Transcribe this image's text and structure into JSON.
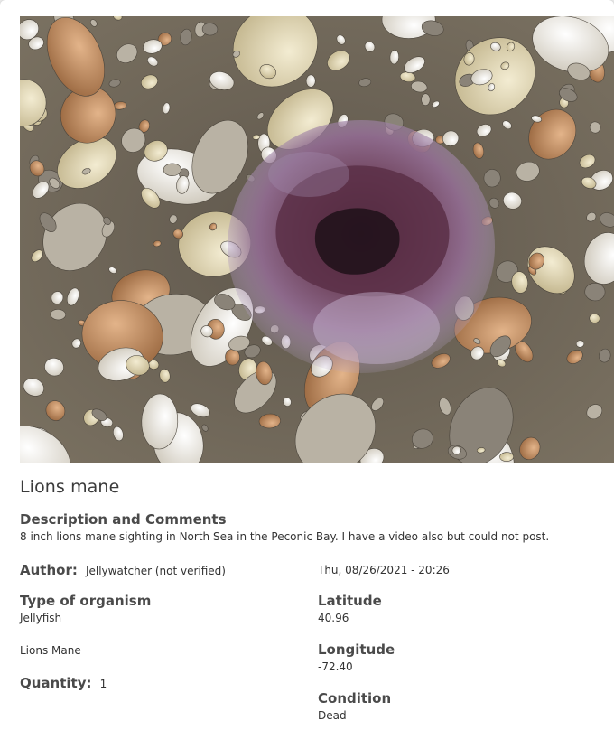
{
  "observation": {
    "photo_alt": "Lions mane jellyfish on pebbly beach",
    "title": "Lions mane",
    "description_label": "Description and Comments",
    "description": "8 inch lions mane sighting in North Sea in the Peconic Bay. I have a video also but could not post.",
    "author_label": "Author:",
    "author_value": "Jellywatcher (not verified)",
    "datetime": "Thu, 08/26/2021 - 20:26",
    "organism_label": "Type of organism",
    "organism_value": "Jellyfish",
    "species": "Lions Mane",
    "quantity_label": "Quantity:",
    "quantity_value": "1",
    "latitude_label": "Latitude",
    "latitude_value": "40.96",
    "longitude_label": "Longitude",
    "longitude_value": "-72.40",
    "condition_label": "Condition",
    "condition_value": "Dead"
  },
  "colors": {
    "heading": "#4a4a4a",
    "text": "#333333",
    "card_bg": "#ffffff",
    "page_bg": "#e9e9e9"
  }
}
